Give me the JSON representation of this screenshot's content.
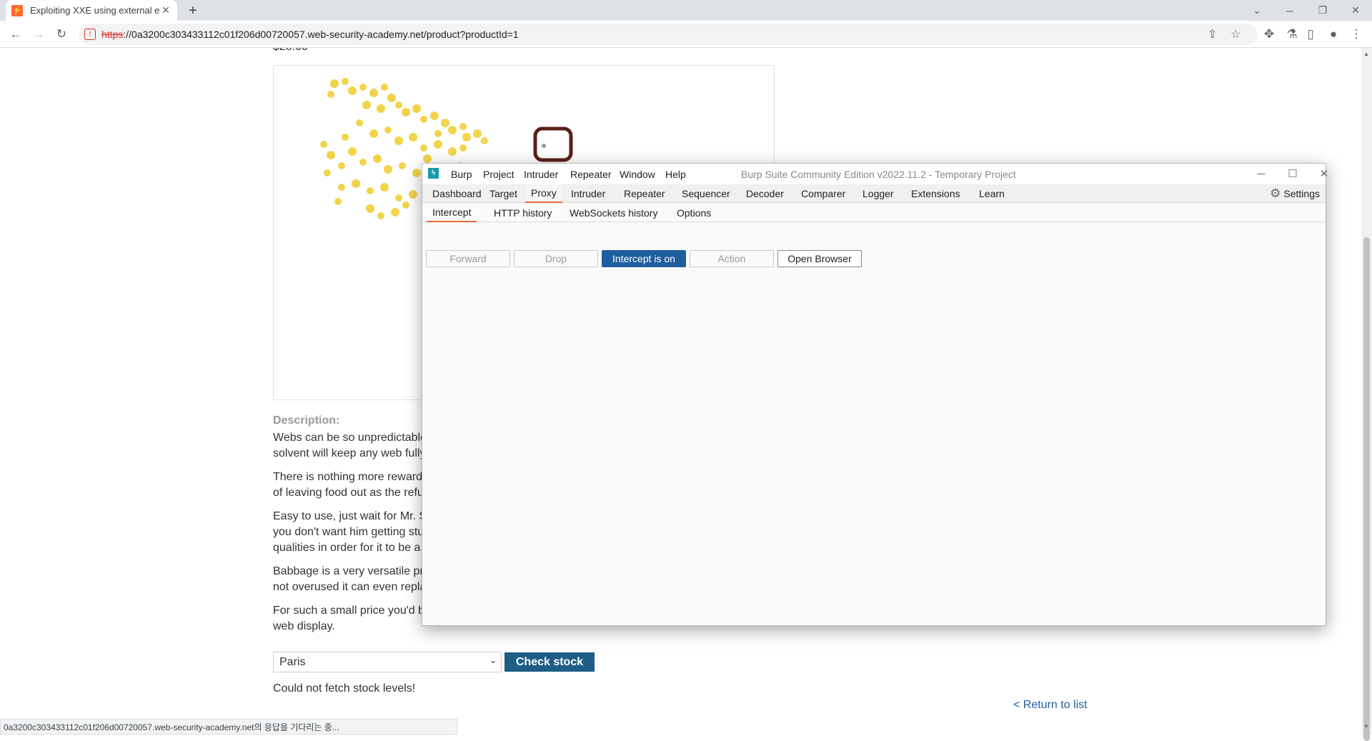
{
  "browser": {
    "tab_title": "Exploiting XXE using external en",
    "tab_close": "✕",
    "new_tab": "+",
    "url_scheme": "https",
    "url_rest": "://0a3200c303433112c01f206d00720057.web-security-academy.net/product?productId=1",
    "status_text": "0a3200c303433112c01f206d00720057.web-security-academy.net의 응답을 기다리는 중..."
  },
  "page": {
    "price_partial": "$28.00",
    "description_label": "Description:",
    "description_lines": [
      "Webs can be so unpredictable",
      "solvent will keep any web fully",
      "There is nothing more reward",
      "of leaving food out as the refu",
      "Easy to use, just wait for Mr. S",
      "you don't want him getting stu",
      "qualities in order for it to be a",
      "Babbage is a very versatile pr",
      "not overused it can even repla",
      "For such a small price you'd b",
      "web display."
    ],
    "stock_select_value": "Paris",
    "check_stock_label": "Check stock",
    "stock_error": "Could not fetch stock levels!",
    "return_link": "< Return to list"
  },
  "burp": {
    "window_title": "Burp Suite Community Edition v2022.11.2 - Temporary Project",
    "menu": [
      "Burp",
      "Project",
      "Intruder",
      "Repeater",
      "Window",
      "Help"
    ],
    "tabs": [
      "Dashboard",
      "Target",
      "Proxy",
      "Intruder",
      "Repeater",
      "Sequencer",
      "Decoder",
      "Comparer",
      "Logger",
      "Extensions",
      "Learn"
    ],
    "active_tab": "Proxy",
    "settings_label": "Settings",
    "subtabs": [
      "Intercept",
      "HTTP history",
      "WebSockets history",
      "Options"
    ],
    "active_subtab": "Intercept",
    "buttons": {
      "forward": "Forward",
      "drop": "Drop",
      "intercept": "Intercept is on",
      "action": "Action",
      "open_browser": "Open Browser"
    }
  }
}
